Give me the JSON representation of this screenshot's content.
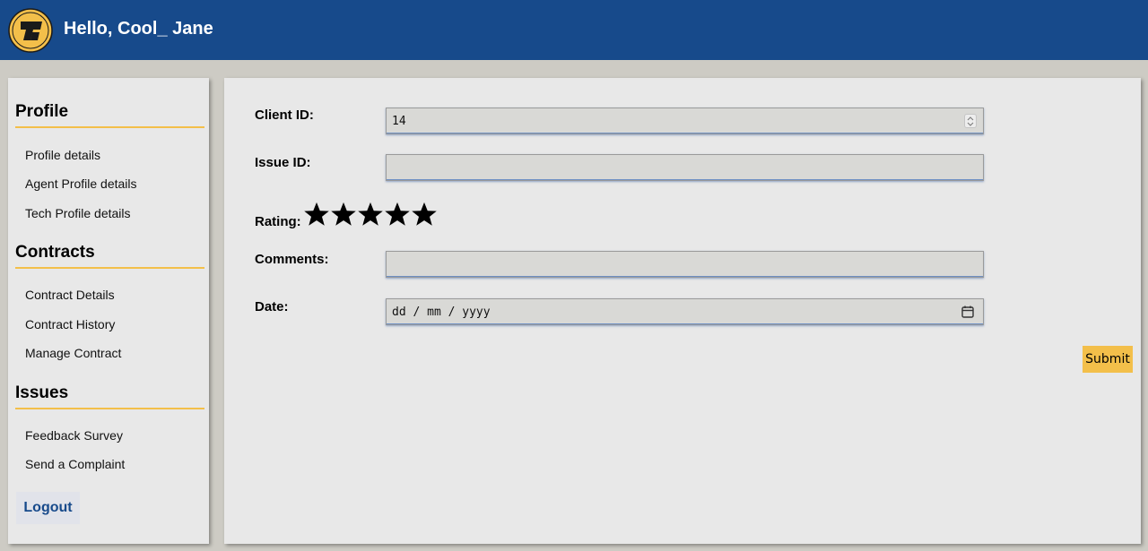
{
  "header": {
    "greeting": "Hello, Cool_ Jane",
    "logo_icon": "company-logo-icon",
    "bg_color": "#174a8b"
  },
  "sidebar": {
    "sections": [
      {
        "title": "Profile",
        "items": [
          "Profile details",
          "Agent Profile details",
          "Tech Profile details"
        ]
      },
      {
        "title": "Contracts",
        "items": [
          "Contract Details",
          "Contract History",
          "Manage Contract"
        ]
      },
      {
        "title": "Issues",
        "items": [
          "Feedback Survey",
          "Send a Complaint"
        ]
      }
    ],
    "logout_label": "Logout",
    "accent_color": "#f3bf4a"
  },
  "form": {
    "client_id_label": "Client ID:",
    "client_id_value": "14",
    "issue_id_label": "Issue ID:",
    "issue_id_value": "",
    "rating_label": "Rating:",
    "rating_stars": 5,
    "comments_label": "Comments:",
    "comments_value": "",
    "date_label": "Date:",
    "date_placeholder": "dd / mm / yyyy",
    "submit_label": "Submit"
  }
}
